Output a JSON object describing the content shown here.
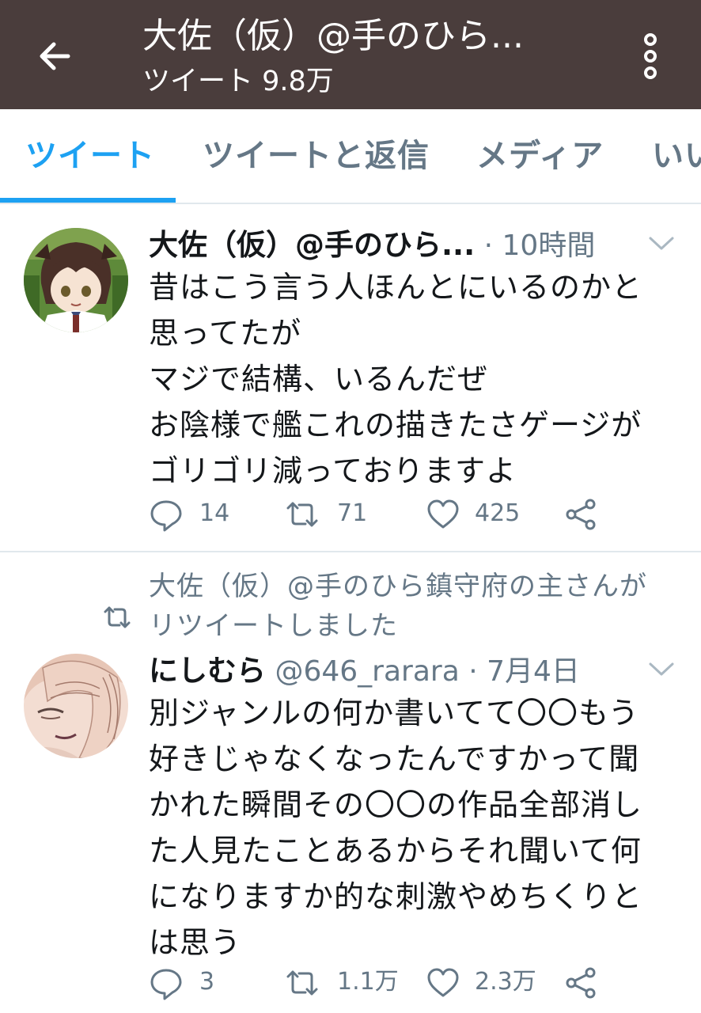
{
  "header": {
    "back_icon": "arrow-left-icon",
    "title": "大佐（仮）@手のひら...",
    "subtitle": "ツイート 9.8万",
    "more_icon": "vertical-ellipsis-icon",
    "bg_color": "#4a3d3c"
  },
  "tabs": [
    {
      "label": "ツイート",
      "active": true
    },
    {
      "label": "ツイートと返信",
      "active": false
    },
    {
      "label": "メディア",
      "active": false
    },
    {
      "label": "いい",
      "active": false
    }
  ],
  "accent_color": "#1da1f2",
  "tweets": [
    {
      "display_name": "大佐（仮）@手のひら...",
      "handle": "",
      "time": "· 10時間",
      "text_lines": [
        "昔はこう言う人ほんとにいるのかと",
        "思ってたが",
        "マジで結構、いるんだぜ",
        "お陰様で艦これの描きたさゲージが",
        "ゴリゴリ減っておりますよ"
      ],
      "replies": "14",
      "retweets": "71",
      "likes": "425"
    },
    {
      "retweet_context_lines": [
        "大佐（仮）@手のひら鎮守府の主さんが",
        "リツイートしました"
      ],
      "display_name": "にしむら",
      "handle": "@646_rarara",
      "time": "· 7月4日",
      "text_lines": [
        "別ジャンルの何か書いてて〇〇もう",
        "好きじゃなくなったんですかって聞",
        "かれた瞬間その〇〇の作品全部消し",
        "た人見たことあるからそれ聞いて何",
        "になりますか的な刺激やめちくりと",
        "は思う"
      ],
      "replies": "3",
      "retweets": "1.1万",
      "likes": "2.3万"
    }
  ]
}
